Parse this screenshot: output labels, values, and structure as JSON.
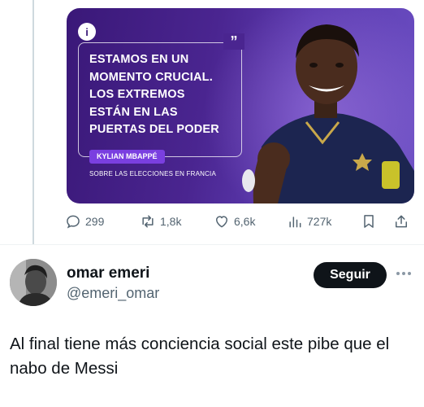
{
  "quoted_media": {
    "logo_letter": "i",
    "quote_mark": "”",
    "quote_lines": [
      "ESTAMOS EN UN",
      "MOMENTO CRUCIAL.",
      "LOS EXTREMOS",
      "ESTÁN EN LAS",
      "PUERTAS DEL PODER"
    ],
    "author": "KYLIAN MBAPPÉ",
    "subtitle": "SOBRE LAS ELECCIONES EN FRANCIA"
  },
  "actions": {
    "replies": "299",
    "reposts": "1,8k",
    "likes": "6,6k",
    "views": "727k"
  },
  "post": {
    "display_name": "omar emeri",
    "handle": "@emeri_omar",
    "follow_label": "Seguir",
    "text": "Al final tiene más conciencia social este pibe que el nabo de Messi"
  },
  "colors": {
    "accent_purple": "#4a2590",
    "text_primary": "#0f1419",
    "text_secondary": "#536471",
    "button_dark": "#0f1419"
  }
}
